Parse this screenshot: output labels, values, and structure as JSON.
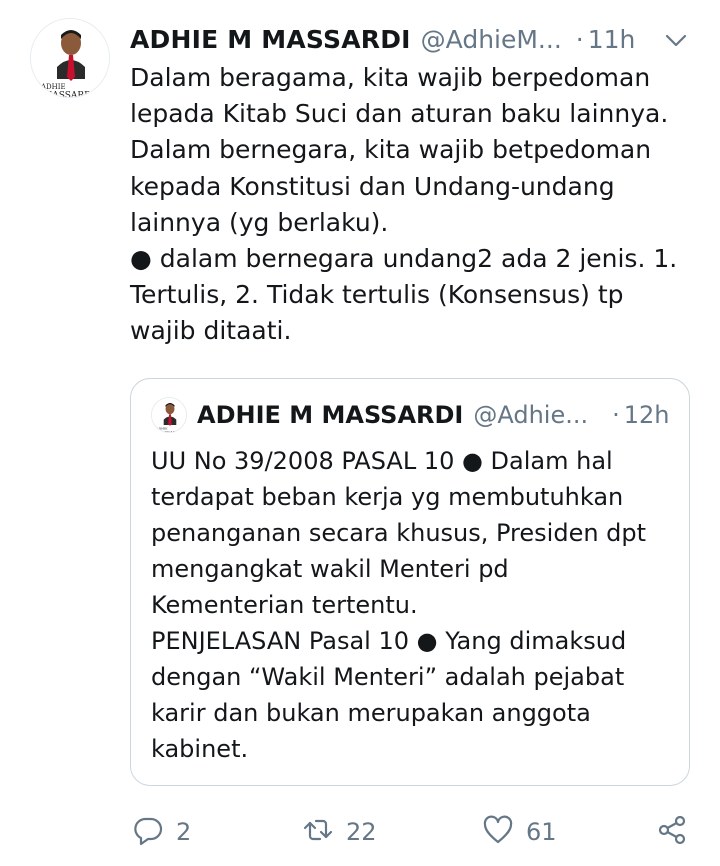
{
  "tweet": {
    "author_name": "ADHIE M MASSARDI",
    "author_handle": "@AdhieM...",
    "separator": "·",
    "time": "11h",
    "avatar_logo_text": "ADHIE MASSARDI",
    "text": "Dalam beragama, kita wajib berpedoman\nlepada Kitab Suci dan aturan baku lainnya.\nDalam bernegara, kita wajib betpedoman\nkepada Konstitusi dan Undang-undang\nlainnya (yg berlaku).\n● dalam bernegara undang2 ada 2 jenis. 1.\nTertulis, 2. Tidak tertulis (Konsensus) tp\nwajib ditaati."
  },
  "quoted_tweet": {
    "author_name": "ADHIE M MASSARDI",
    "author_handle": "@Adhie...",
    "separator": "·",
    "time": "12h",
    "text": "UU No 39/2008 PASAL 10 ● Dalam hal\nterdapat beban kerja yg membutuhkan\npenanganan secara khusus, Presiden dpt\nmengangkat wakil Menteri pd\nKementerian tertentu.\nPENJELASAN Pasal 10 ● Yang dimaksud\ndengan “Wakil Menteri” adalah pejabat\nkarir dan bukan merupakan anggota\nkabinet."
  },
  "actions": {
    "reply_count": "2",
    "retweet_count": "22",
    "like_count": "61"
  },
  "icons": {
    "reply": "reply-icon",
    "retweet": "retweet-icon",
    "like": "heart-icon",
    "share": "share-icon",
    "caret": "chevron-down-icon"
  },
  "colors": {
    "text": "#14171a",
    "secondary": "#657786",
    "border": "#ccd6dd",
    "logo_red": "#c8102e"
  }
}
